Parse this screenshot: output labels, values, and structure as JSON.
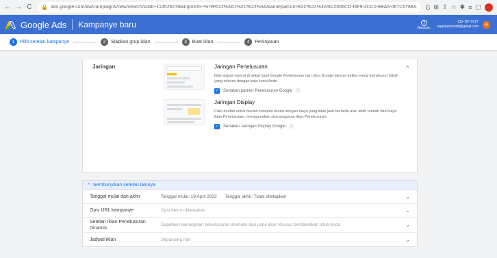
{
  "browser": {
    "back": "←",
    "forward": "→",
    "reload": "C",
    "url": "ads.google.com/aw/campaigns/new/search/sold/~114526278lampnInfo~%7B%22%3A1%2C%22%3A/kamieparcom%2C%22%3A%22006CD-f4F9-4CC0-8BA5-067C5788A..."
  },
  "header": {
    "brand": "Google Ads",
    "page_title": "Kampanye baru",
    "help_label": "Bantuan",
    "account_id": "115-167-9127",
    "account_email": "registrasicredit@gmail.com",
    "avatar_letter": "R"
  },
  "stepper": [
    {
      "num": "1",
      "label": "Pilih setelan kampanye"
    },
    {
      "num": "2",
      "label": "Siapkan grup iklan"
    },
    {
      "num": "3",
      "label": "Buat iklan"
    },
    {
      "num": "4",
      "label": "Peninjauan"
    }
  ],
  "network": {
    "label": "Jaringan",
    "search": {
      "title": "Jaringan Penelusuran",
      "desc": "Iklan dapat muncul di dekat hasil Google Penelusuran dan situs Google lainnya ketika orang menelusuri istilah yang relevan dengan kata kunci Anda",
      "checkbox": "Sertakan partner Penelusuran Google"
    },
    "display": {
      "title": "Jaringan Display",
      "desc": "Cara mudah untuk meraih konversi ekstra dengan biaya yang tidak jauh berbeda atau lebih rendah dari biaya iklan Penelusuran, menggunakan sisa anggaran iklan Penelusuran.",
      "checkbox": "Sertakan Jaringan Display Google"
    }
  },
  "hide_settings": "Sembunyikan setelan lainnya",
  "rows": [
    {
      "label": "Tanggal mulai dan akhir",
      "value1": "Tanggal mulai: 19 April 2023",
      "value2": "Tanggal akhir: Tidak ditetapkan"
    },
    {
      "label": "Opsi URL kampanye",
      "value1": "Opsi belum ditetapkan"
    },
    {
      "label": "Setelan Iklan Penelusuran Dinamis",
      "value1": "Dapatkan penargetan penelusuran otomatis dan judul iklan khusus berdasarkan situs Anda"
    },
    {
      "label": "Jadwal iklan",
      "value1": "Sepanjang hari"
    }
  ],
  "colors": {
    "primary": "#1a73e8",
    "header": "#3b6fd1"
  }
}
